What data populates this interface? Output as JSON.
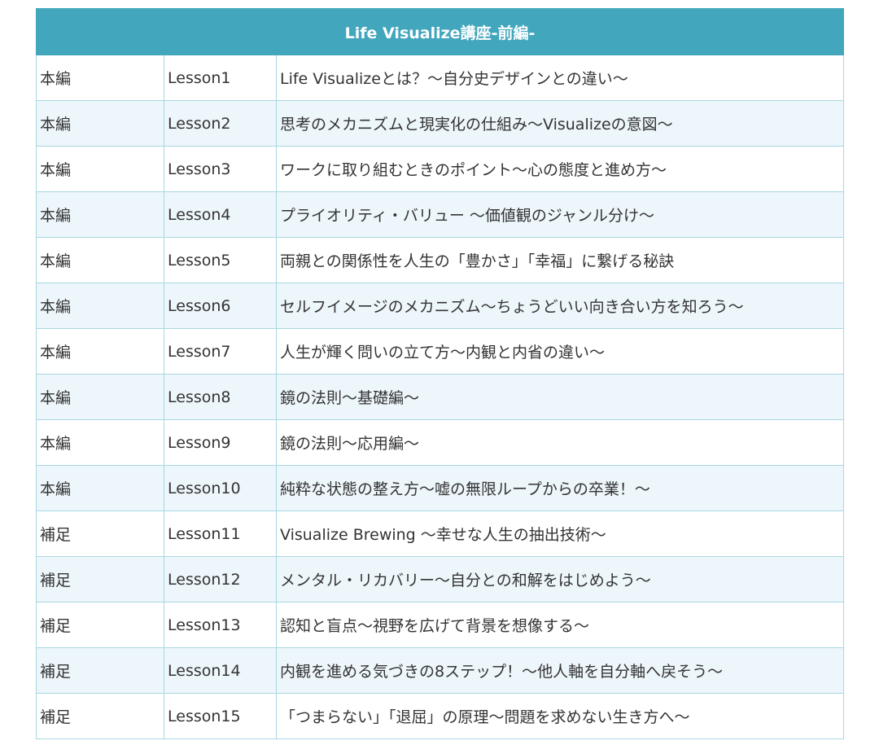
{
  "table": {
    "title": "Life Visualize講座-前編-",
    "rows": [
      {
        "type": "本編",
        "lesson": "Lesson1",
        "title": "Life Visualizeとは？～自分史デザインとの違い～"
      },
      {
        "type": "本編",
        "lesson": "Lesson2",
        "title": "思考のメカニズムと現実化の仕組み～Visualizeの意図～"
      },
      {
        "type": "本編",
        "lesson": "Lesson3",
        "title": "ワークに取り組むときのポイント～心の態度と進め方～"
      },
      {
        "type": "本編",
        "lesson": "Lesson4",
        "title": "プライオリティ・バリュー ～価値観のジャンル分け～"
      },
      {
        "type": "本編",
        "lesson": "Lesson5",
        "title": "両親との関係性を人生の「豊かさ」「幸福」に繋げる秘訣"
      },
      {
        "type": "本編",
        "lesson": "Lesson6",
        "title": "セルフイメージのメカニズム～ちょうどいい向き合い方を知ろう～"
      },
      {
        "type": "本編",
        "lesson": "Lesson7",
        "title": "人生が輝く問いの立て方～内観と内省の違い～"
      },
      {
        "type": "本編",
        "lesson": "Lesson8",
        "title": "鏡の法則～基礎編～"
      },
      {
        "type": "本編",
        "lesson": "Lesson9",
        "title": "鏡の法則～応用編～"
      },
      {
        "type": "本編",
        "lesson": "Lesson10",
        "title": "純粋な状態の整え方～嘘の無限ループからの卒業！～"
      },
      {
        "type": "補足",
        "lesson": "Lesson11",
        "title": "Visualize Brewing ～幸せな人生の抽出技術～"
      },
      {
        "type": "補足",
        "lesson": "Lesson12",
        "title": "メンタル・リカバリー～自分との和解をはじめよう～"
      },
      {
        "type": "補足",
        "lesson": "Lesson13",
        "title": "認知と盲点～視野を広げて背景を想像する～"
      },
      {
        "type": "補足",
        "lesson": "Lesson14",
        "title": "内観を進める気づきの8ステップ！～他人軸を自分軸へ戻そう～"
      },
      {
        "type": "補足",
        "lesson": "Lesson15",
        "title": "「つまらない」「退屈」の原理～問題を求めない生き方へ～"
      }
    ]
  },
  "colors": {
    "header_bg": "#42a6bd",
    "header_text": "#ffffff",
    "row_alt_bg": "#edf6fb",
    "border": "#a9d7e2"
  }
}
